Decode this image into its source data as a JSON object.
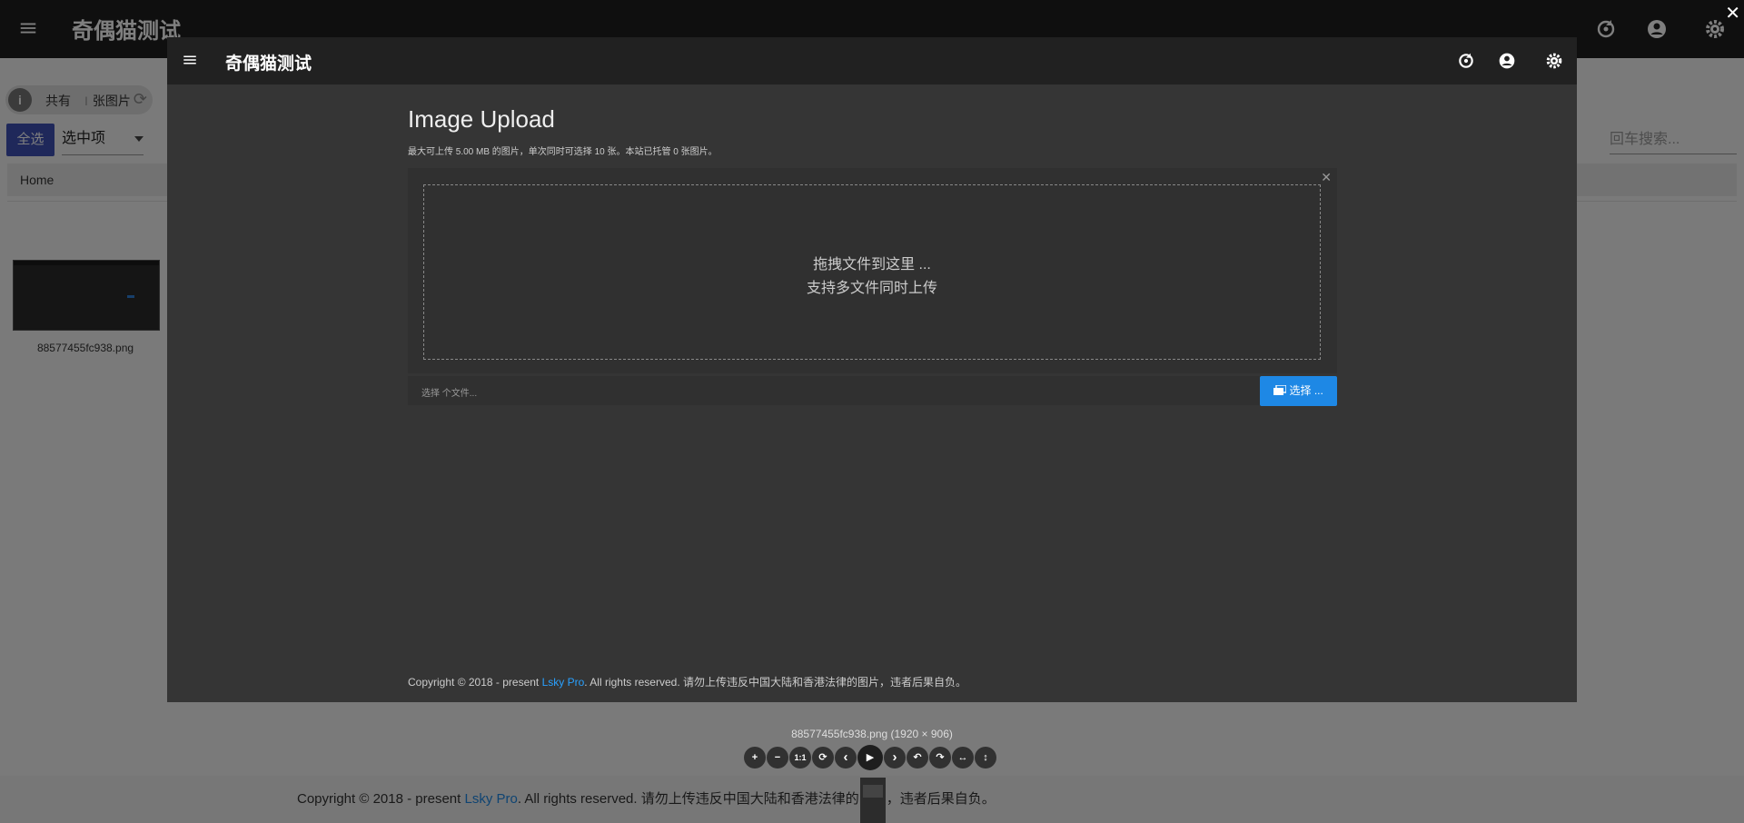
{
  "app": {
    "title": "奇偶猫测试"
  },
  "background_page": {
    "info_chip": {
      "prefix": "共有",
      "count": "",
      "suffix": "张图片"
    },
    "select_all_label": "全选",
    "selection_dropdown": "选中项",
    "search_placeholder": "回车搜索...",
    "breadcrumb": "Home",
    "image_item": {
      "filename": "88577455fc938.png"
    },
    "footer": {
      "prefix": "Copyright © 2018 - present ",
      "link": "Lsky Pro",
      "suffix": ". All rights reserved. 请勿上传违反中国大陆和香港法律的图片，违者后果自负。"
    }
  },
  "preview": {
    "page_title": "Image Upload",
    "subtitle": "最大可上传 5.00 MB 的图片，单次同时可选择 10 张。本站已托管 0 张图片。",
    "drop_zone": {
      "line1": "拖拽文件到这里 ...",
      "line2": "支持多文件同时上传"
    },
    "file_input_placeholder": "选择 个文件...",
    "choose_button": "选择 ...",
    "footer": {
      "prefix": "Copyright © 2018 - present ",
      "link": "Lsky Pro",
      "suffix": ". All rights reserved. 请勿上传违反中国大陆和香港法律的图片，违者后果自负。"
    }
  },
  "viewer": {
    "caption": "88577455fc938.png (1920 × 906)",
    "close_glyph": "✕",
    "toolbar": [
      {
        "name": "zoom-in-button",
        "glyph": "+"
      },
      {
        "name": "zoom-out-button",
        "glyph": "−"
      },
      {
        "name": "one-to-one-button",
        "glyph": "1:1"
      },
      {
        "name": "reset-button",
        "glyph": "⟳"
      },
      {
        "name": "prev-button",
        "glyph": "‹"
      },
      {
        "name": "play-button",
        "glyph": "▶"
      },
      {
        "name": "next-button",
        "glyph": "›"
      },
      {
        "name": "rotate-left-button",
        "glyph": "↶"
      },
      {
        "name": "rotate-right-button",
        "glyph": "↷"
      },
      {
        "name": "flip-horizontal-button",
        "glyph": "↔"
      },
      {
        "name": "flip-vertical-button",
        "glyph": "↕"
      }
    ]
  },
  "colors": {
    "primary": "#3f51b5",
    "accent_blue": "#1e88e5",
    "preview_bg": "#353535",
    "topbar": "#212121"
  },
  "icons": [
    "menu-icon",
    "refresh-icon",
    "account-icon",
    "settings-icon",
    "info-icon",
    "close-icon"
  ]
}
